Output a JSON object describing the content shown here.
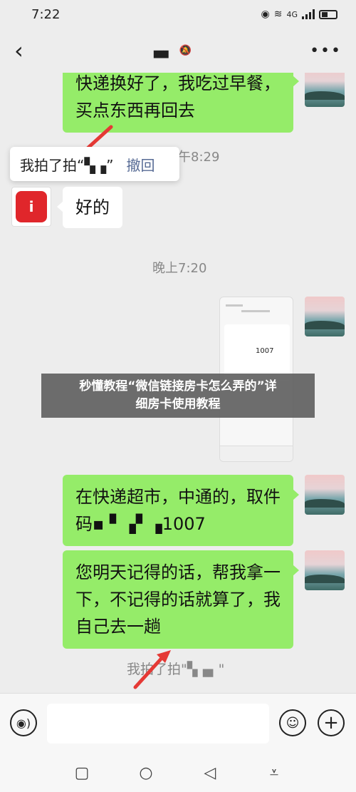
{
  "status_bar": {
    "time": "7:22",
    "network": "4G"
  },
  "header": {
    "title": "▄▖"
  },
  "messages": {
    "top_bubble_line1": "快递换好了，我吃过早餐，",
    "top_bubble_line2": "买点东西再回去",
    "pat_popup_text": "我拍了拍“▚▗”",
    "pat_popup_revoke": "撤回",
    "time1": "午8:29",
    "reply_text": "好的",
    "time2": "晚上7:20",
    "thumb_code": "1007",
    "bubble2_line1": "在快递超市，中通的，取件",
    "bubble2_line2": "码▪ ▘▗▘▗1007",
    "bubble3_line1": "您明天记得的话，帮我拿一",
    "bubble3_line2": "下，不记得的话就算了，我",
    "bubble3_line3": "自己去一趟",
    "pat_notice": "我拍了拍\"▚▗▖\""
  },
  "overlay": {
    "line1": "秒懂教程“微信链接房卡怎么弄的”详",
    "line2": "细房卡使用教程"
  },
  "input_bar": {
    "placeholder": ""
  },
  "colors": {
    "bubble_green": "#95ec69",
    "link_blue": "#576b95",
    "arrow_red": "#e53935"
  }
}
